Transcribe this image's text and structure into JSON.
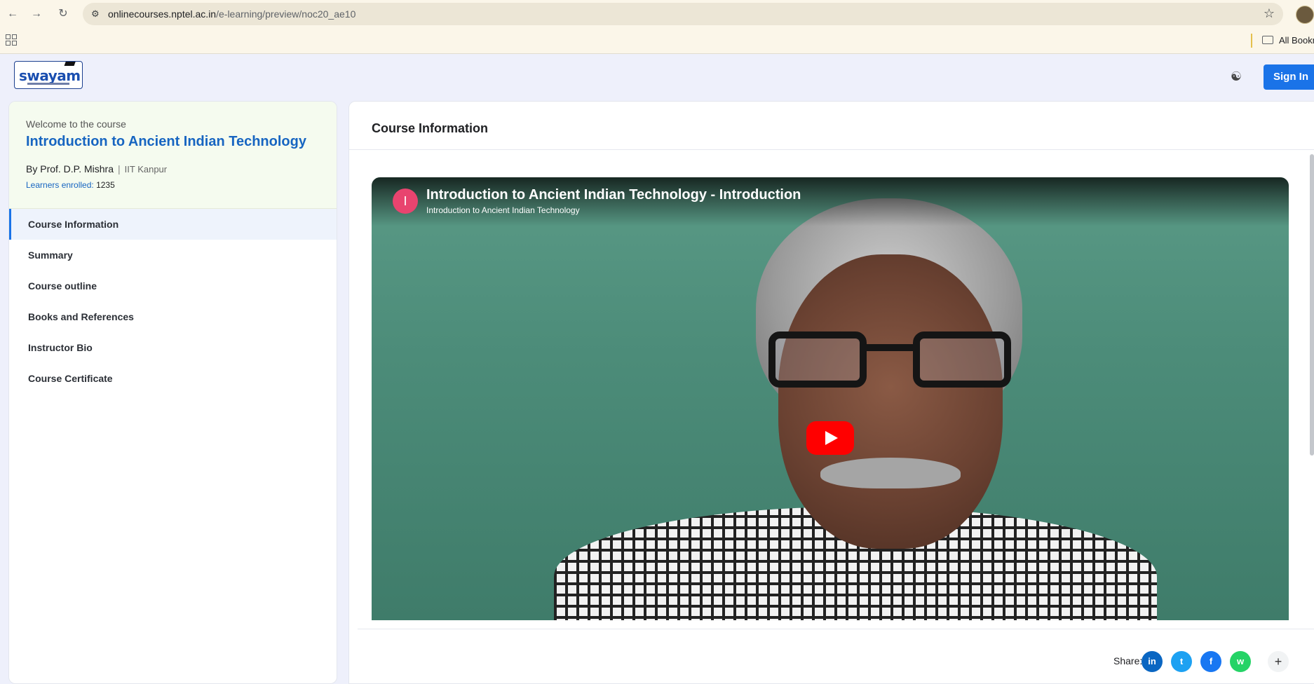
{
  "browser": {
    "url_domain": "onlinecourses.nptel.ac.in",
    "url_path": "/e-learning/preview/noc20_ae10",
    "bookmarks_label": "All Bookm"
  },
  "header": {
    "logo_text": "swayam",
    "sign_in_label": "Sign In"
  },
  "course": {
    "welcome": "Welcome to the course",
    "title": "Introduction to Ancient Indian Technology",
    "instructor": "By Prof. D.P. Mishra",
    "separator": "|",
    "institute": "IIT Kanpur",
    "learners_label": "Learners enrolled:",
    "learners_count": "1235"
  },
  "sidebar": {
    "items": [
      {
        "label": "Course Information"
      },
      {
        "label": "Summary"
      },
      {
        "label": "Course outline"
      },
      {
        "label": "Books and References"
      },
      {
        "label": "Instructor Bio"
      },
      {
        "label": "Course Certificate"
      }
    ]
  },
  "main": {
    "title": "Course Information",
    "video": {
      "channel_initial": "I",
      "title": "Introduction to Ancient Indian Technology - Introduction",
      "subtitle": "Introduction to Ancient Indian Technology"
    },
    "share": {
      "label": "Share:",
      "buttons": [
        {
          "icon": "linkedin-icon",
          "glyph": "in",
          "color": "#0a66c2"
        },
        {
          "icon": "twitter-icon",
          "glyph": "t",
          "color": "#1da1f2"
        },
        {
          "icon": "facebook-icon",
          "glyph": "f",
          "color": "#1877f2"
        },
        {
          "icon": "whatsapp-icon",
          "glyph": "w",
          "color": "#25d366"
        }
      ],
      "more_glyph": "+"
    }
  },
  "colors": {
    "accent": "#1a73e8",
    "course_title": "#1765c1",
    "play_button": "#ff0000"
  }
}
